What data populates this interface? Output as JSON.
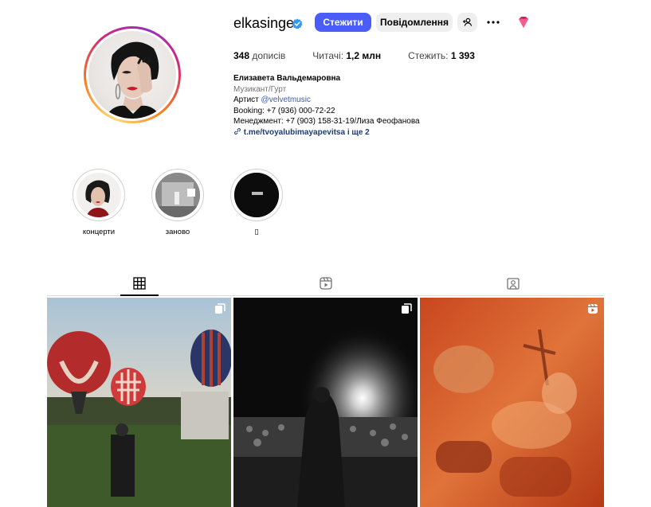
{
  "profile": {
    "username": "elkasinger",
    "follow_label": "Стежити",
    "message_label": "Повідомлення",
    "more_label": "•••"
  },
  "stats": {
    "posts_count": "348",
    "posts_label": "дописів",
    "followers_label": "Читачі:",
    "followers_count": "1,2 млн",
    "following_label": "Стежить:",
    "following_count": "1 393"
  },
  "bio": {
    "full_name": "Елизавета Вальдемаровна",
    "category": "Музикант/Гурт",
    "artist_prefix": "Артист",
    "artist_mention": "@velvetmusic",
    "booking": "Booking: +7 (936) 000-72-22",
    "management": "Менеджмент: +7 (903) 158-31-19/Лиза Феофанова",
    "link": "t.me/tvoyalubimayapevitsa і ще 2"
  },
  "highlights": [
    {
      "label": "концерти"
    },
    {
      "label": "заново"
    },
    {
      "label": "▯"
    }
  ],
  "tabs": [
    {
      "icon": "grid-icon",
      "active": true
    },
    {
      "icon": "reels-icon",
      "active": false
    },
    {
      "icon": "tagged-icon",
      "active": false
    }
  ],
  "posts": [
    {
      "badge": "carousel-icon",
      "subject": "hot air balloons at sunset"
    },
    {
      "badge": "carousel-icon",
      "subject": "black and white concert stage"
    },
    {
      "badge": "reel-icon",
      "subject": "red-tinted drum kit"
    }
  ],
  "colors": {
    "follow_button": "#4a5df9",
    "secondary_button": "#efefef",
    "verified": "#3897f0",
    "link": "#1d3a75"
  }
}
